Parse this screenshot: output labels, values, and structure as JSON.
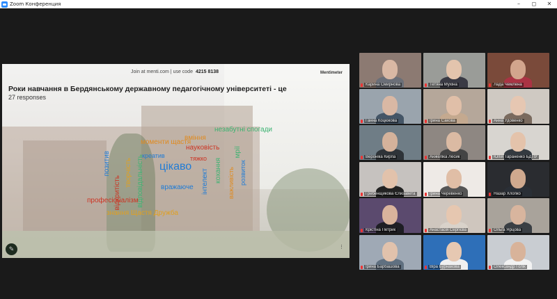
{
  "window": {
    "title": "Zoom Конференция"
  },
  "slide": {
    "join_text": "Join at menti.com | use code",
    "join_code": "4215 8138",
    "brand": "Mentimeter",
    "question": "Роки навчання в Бердянському державному педагогічному університеті - це",
    "responses": "27 responses",
    "words": [
      {
        "text": "незабутні спогади",
        "color": "#3cb371",
        "vertical": false
      },
      {
        "text": "вміння",
        "color": "#e08a1e",
        "vertical": false
      },
      {
        "text": "моменти щастя",
        "color": "#e08a1e",
        "vertical": false
      },
      {
        "text": "науковість",
        "color": "#cc3322",
        "vertical": false
      },
      {
        "text": "креатив",
        "color": "#1f7bd6",
        "vertical": false
      },
      {
        "text": "тяжко",
        "color": "#cc3322",
        "vertical": false
      },
      {
        "text": "цікаво",
        "color": "#1f7bd6",
        "vertical": false
      },
      {
        "text": "вражаюче",
        "color": "#1f7bd6",
        "vertical": false
      },
      {
        "text": "професіоналізм",
        "color": "#cc3322",
        "vertical": false
      },
      {
        "text": "знання Щастя Дружба",
        "color": "#e0a020",
        "vertical": false
      },
      {
        "text": "позитив",
        "color": "#1f7bd6",
        "vertical": true
      },
      {
        "text": "відкритість",
        "color": "#cc3322",
        "vertical": true
      },
      {
        "text": "творчість",
        "color": "#e0a020",
        "vertical": true
      },
      {
        "text": "відповідальність",
        "color": "#3cb371",
        "vertical": true
      },
      {
        "text": "інтелект",
        "color": "#1f7bd6",
        "vertical": true
      },
      {
        "text": "кохання",
        "color": "#3cb371",
        "vertical": true
      },
      {
        "text": "важливість",
        "color": "#e08a1e",
        "vertical": true
      },
      {
        "text": "розвиток",
        "color": "#1f7bd6",
        "vertical": true
      },
      {
        "text": "мрії",
        "color": "#3cb371",
        "vertical": true
      }
    ]
  },
  "participants": [
    {
      "name": "Карина Смирнова",
      "bg": "#8c7a72",
      "skin": "#d9b8a4",
      "shirt": "#6b6f78"
    },
    {
      "name": "Тетяна Мухіна",
      "bg": "#9a9c98",
      "skin": "#e3c4ad",
      "shirt": "#3a3a44"
    },
    {
      "name": "Лада Чемлена",
      "bg": "#7a4a3a",
      "skin": "#d2a58d",
      "shirt": "#aa3344"
    },
    {
      "name": "Ганна Коцюкова",
      "bg": "#9aa4ad",
      "skin": "#d9b8a4",
      "shirt": "#445566"
    },
    {
      "name": "Ірина Сакова",
      "bg": "#b5a79a",
      "skin": "#e0bfa8",
      "shirt": "#c4a98f"
    },
    {
      "name": "Анна Удовенко",
      "bg": "#cfc9c2",
      "skin": "#e6c7b2",
      "shirt": "#7a6a5e"
    },
    {
      "name": "Вероніка Кирпа",
      "bg": "#6f7d86",
      "skin": "#d4b29b",
      "shirt": "#2e3338"
    },
    {
      "name": "Анжеліка Лесик",
      "bg": "#8e8782",
      "skin": "#dbbaa3",
      "shirt": "#444"
    },
    {
      "name": "Юлія Тараненко БДПУ",
      "bg": "#d8d5d0",
      "skin": "#e4c3ab",
      "shirt": "#343a40"
    },
    {
      "name": "Гребенщикова Єлизавета",
      "bg": "#c6c2bf",
      "skin": "#e2c2ab",
      "shirt": "#222"
    },
    {
      "name": "Ірина Черевенко",
      "bg": "#eeeae6",
      "skin": "#e0bea6",
      "shirt": "#555"
    },
    {
      "name": "Назар Хлопко",
      "bg": "#2a2c30",
      "skin": "#cfa98e",
      "shirt": "#2a2f36"
    },
    {
      "name": "Крістіна Петрик",
      "bg": "#5b4a6e",
      "skin": "#d9b49c",
      "shirt": "#1e1e24"
    },
    {
      "name": "Анастасія Сергієва",
      "bg": "#cfc6be",
      "skin": "#e6c7b0",
      "shirt": "#d9d2ca"
    },
    {
      "name": "Ольга Ярцова",
      "bg": "#a9a39b",
      "skin": "#d8b59e",
      "shirt": "#3a3f44"
    },
    {
      "name": "Ірина Барбашова",
      "bg": "#9fa9b5",
      "skin": "#e1c2ac",
      "shirt": "#607080"
    },
    {
      "name": "Віра Бурнакова",
      "bg": "#2e6fb8",
      "skin": "#e6c8b2",
      "shirt": "#f0f0f0"
    },
    {
      "name": "Олександр Голік",
      "bg": "#c9cdd2",
      "skin": "#d8b39a",
      "shirt": "#f2f2f2"
    }
  ]
}
